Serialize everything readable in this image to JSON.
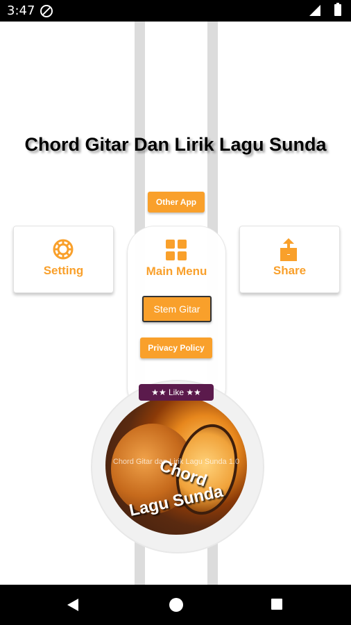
{
  "status_bar": {
    "time": "3:47"
  },
  "app": {
    "title": "Chord Gitar Dan Lirik Lagu Sunda"
  },
  "buttons": {
    "other_app": "Other App",
    "stem_gitar": "Stem Gitar",
    "privacy_policy": "Privacy Policy",
    "like": "★★ Like ★★"
  },
  "cards": {
    "setting": "Setting",
    "main_menu": "Main Menu",
    "share": "Share"
  },
  "icons": {
    "setting": "gear-icon",
    "main_menu": "grid-icon",
    "share": "share-icon"
  },
  "drum_image": {
    "caption": "Chord Gitar dan Lirik Lagu Sunda 1.0",
    "arc_line_1": "Chord",
    "arc_line_2": "Lagu Sunda"
  },
  "colors": {
    "accent": "#f9a02b",
    "like_bg": "#5b1a4c",
    "bars": "#000000"
  }
}
